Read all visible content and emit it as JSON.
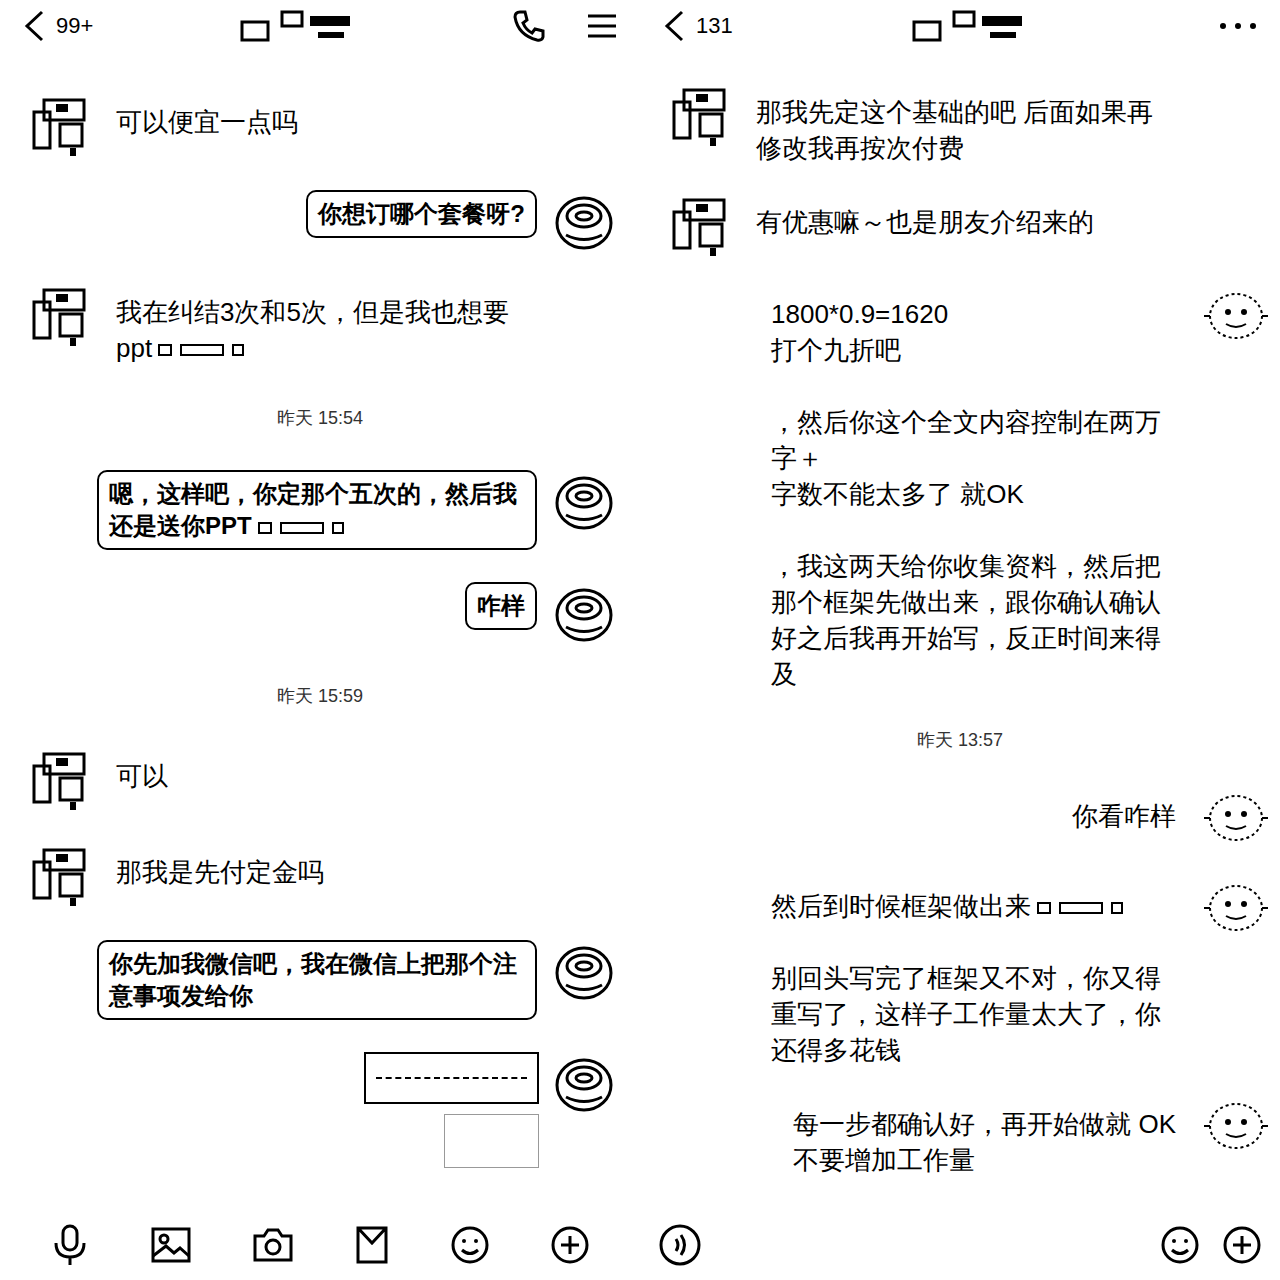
{
  "chats": [
    {
      "header": {
        "unread": "99+"
      },
      "messages": [
        {
          "kind": "text",
          "side": "left",
          "parts": [
            {
              "text": "可以便宜一点吗",
              "redacted": false
            }
          ]
        },
        {
          "kind": "bubble",
          "side": "right",
          "parts": [
            {
              "text": "你想订哪个套餐呀?",
              "redacted": false
            }
          ]
        },
        {
          "kind": "text",
          "side": "left",
          "parts": [
            {
              "text": "我在纠结3次和5次，但是我也想要ppt",
              "redacted": true
            }
          ]
        },
        {
          "kind": "time",
          "text": "昨天 15:54"
        },
        {
          "kind": "bubble",
          "side": "right",
          "parts": [
            {
              "text": "嗯，这样吧，你定那个五次的，然后我还是送你PPT",
              "redacted": true
            }
          ]
        },
        {
          "kind": "bubble",
          "side": "right",
          "parts": [
            {
              "text": "咋样",
              "redacted": false
            }
          ]
        },
        {
          "kind": "time",
          "text": "昨天 15:59"
        },
        {
          "kind": "text",
          "side": "left",
          "parts": [
            {
              "text": "可以",
              "redacted": false
            }
          ]
        },
        {
          "kind": "text",
          "side": "left",
          "parts": [
            {
              "text": "那我是先付定金吗",
              "redacted": false
            }
          ]
        },
        {
          "kind": "bubble",
          "side": "right",
          "parts": [
            {
              "text": "你先加我微信吧，我在微信上把那个注意事项发给你",
              "redacted": false
            }
          ]
        },
        {
          "kind": "card",
          "side": "right"
        }
      ]
    },
    {
      "header": {
        "unread": "131"
      },
      "messages": [
        {
          "kind": "text",
          "side": "left",
          "parts": [
            {
              "text": "那我先定这个基础的吧 后面如果再修改我再按次付费",
              "redacted": false
            }
          ]
        },
        {
          "kind": "text",
          "side": "left",
          "parts": [
            {
              "text": "有优惠嘛～也是朋友介绍来的",
              "redacted": false
            }
          ]
        },
        {
          "kind": "text",
          "side": "right",
          "parts": [
            {
              "text": "1800*0.9=1620\n打个九折吧",
              "redacted": false
            },
            {
              "text": "，然后你这个全文内容控制在两万字＋\n字数不能太多了 就OK",
              "redacted": false
            },
            {
              "text": "，我这两天给你收集资料，然后把那个框架先做出来，跟你确认确认好之后我再开始写，反正时间来得及",
              "redacted": false
            }
          ]
        },
        {
          "kind": "time",
          "text": "昨天 13:57"
        },
        {
          "kind": "text",
          "side": "right",
          "parts": [
            {
              "text": "你看咋样",
              "redacted": false
            }
          ]
        },
        {
          "kind": "text",
          "side": "right",
          "parts": [
            {
              "text": "然后到时候框架做出来",
              "redacted": true
            },
            {
              "text": "别回头写完了框架又不对，你又得重写了，这样子工作量太大了，你还得多花钱",
              "redacted": false
            }
          ]
        },
        {
          "kind": "text",
          "side": "right",
          "parts": [
            {
              "text": "每一步都确认好，再开始做就 OK\n不要增加工作量",
              "redacted": false
            }
          ]
        }
      ]
    }
  ]
}
